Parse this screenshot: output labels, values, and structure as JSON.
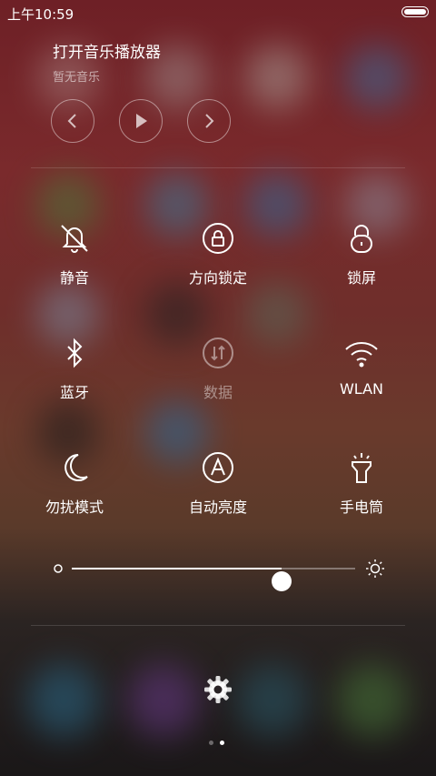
{
  "status": {
    "time": "上午10:59"
  },
  "music": {
    "title": "打开音乐播放器",
    "subtitle": "暂无音乐",
    "prev_icon": "chevron-left-icon",
    "play_icon": "play-icon",
    "next_icon": "chevron-right-icon"
  },
  "toggles": [
    {
      "label": "静音",
      "icon": "bell-mute-icon",
      "active": true
    },
    {
      "label": "方向锁定",
      "icon": "rotation-lock-icon",
      "active": true
    },
    {
      "label": "锁屏",
      "icon": "lock-icon",
      "active": true
    },
    {
      "label": "蓝牙",
      "icon": "bluetooth-icon",
      "active": true
    },
    {
      "label": "数据",
      "icon": "mobile-data-icon",
      "active": false
    },
    {
      "label": "WLAN",
      "icon": "wifi-icon",
      "active": true
    },
    {
      "label": "勿扰模式",
      "icon": "moon-icon",
      "active": true
    },
    {
      "label": "自动亮度",
      "icon": "auto-brightness-icon",
      "active": true
    },
    {
      "label": "手电筒",
      "icon": "flashlight-icon",
      "active": true
    }
  ],
  "brightness": {
    "level_percent": 74
  },
  "pager": {
    "pages": 2,
    "current": 2
  },
  "colors": {
    "active": "#ffffff",
    "inactive": "#ffffff73"
  }
}
